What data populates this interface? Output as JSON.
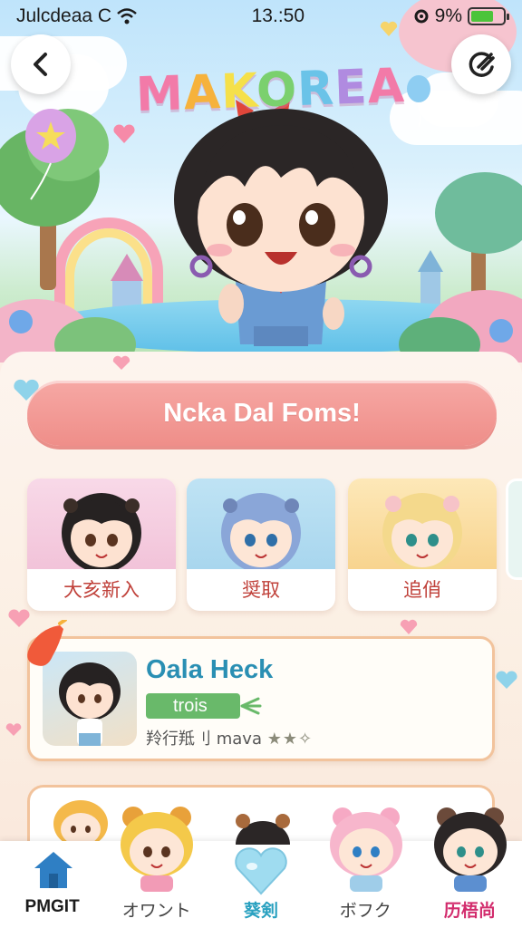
{
  "status_bar": {
    "carrier": "Julcdeaa C",
    "time": "13.:50",
    "battery_text": "9%",
    "battery_level": 0.7
  },
  "header": {
    "back_icon": "chevron-left-icon",
    "action_icon": "refresh-icon",
    "logo_text": "MAKOREA",
    "logo_colors": [
      "#f27aa8",
      "#f6b23c",
      "#f5e04a",
      "#7bd06e",
      "#6ac3e8",
      "#b08be0",
      "#f27aa8"
    ]
  },
  "main": {
    "cta_label": "Ncka Dal Foms!",
    "cards": [
      {
        "label": "大亥新入",
        "bg": "#f6cfe1"
      },
      {
        "label": "奨取",
        "bg": "#bfe3f2"
      },
      {
        "label": "追俏",
        "bg": "#fbe3b4"
      }
    ],
    "feature": {
      "title": "Oala Heck",
      "tag": "trois",
      "meta": "羚行羝刂 mava",
      "stars": "★★✧"
    }
  },
  "nav": {
    "items": [
      {
        "label": "PMGIT",
        "icon": "home-icon"
      },
      {
        "label": "オワント",
        "icon": "character-icon"
      },
      {
        "label": "葵剣",
        "icon": "heart-icon"
      },
      {
        "label": "ボフク",
        "icon": "character-icon"
      },
      {
        "label": "历梧尚",
        "icon": "character-icon"
      }
    ]
  },
  "colors": {
    "accent_pink": "#ef8e89",
    "accent_blue": "#2a8fb3",
    "tag_green": "#69b96a"
  }
}
